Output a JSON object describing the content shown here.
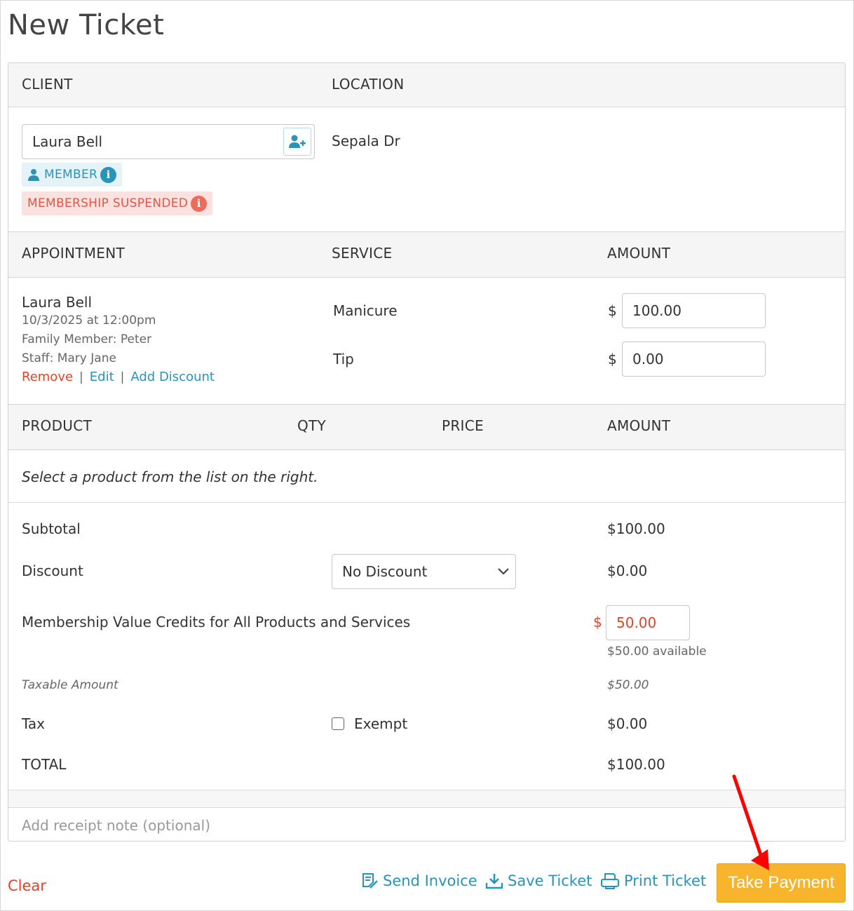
{
  "page": {
    "title": "New Ticket"
  },
  "client_section": {
    "client_header": "CLIENT",
    "location_header": "LOCATION",
    "client_name": "Laura Bell",
    "location_value": "Sepala Dr",
    "member_badge": "MEMBER",
    "suspended_badge": "MEMBERSHIP SUSPENDED"
  },
  "appointment_section": {
    "headers": {
      "appointment": "APPOINTMENT",
      "service": "SERVICE",
      "amount": "AMOUNT"
    },
    "client_name": "Laura Bell",
    "datetime": "10/3/2025 at 12:00pm",
    "family_member": "Family Member: Peter",
    "staff": "Staff: Mary Jane",
    "actions": {
      "remove": "Remove",
      "separator": "|",
      "edit": "Edit",
      "add_discount": "Add Discount"
    },
    "rows": [
      {
        "service": "Manicure",
        "currency": "$",
        "amount": "100.00"
      },
      {
        "service": "Tip",
        "currency": "$",
        "amount": "0.00"
      }
    ]
  },
  "product_section": {
    "headers": {
      "product": "PRODUCT",
      "qty": "QTY",
      "price": "PRICE",
      "amount": "AMOUNT"
    },
    "empty_message": "Select a product from the list on the right."
  },
  "totals": {
    "subtotal_label": "Subtotal",
    "subtotal_value": "$100.00",
    "discount_label": "Discount",
    "discount_select": "No Discount",
    "discount_value": "$0.00",
    "credits_label": "Membership Value Credits for All Products and Services",
    "credits_currency": "$",
    "credits_value": "50.00",
    "credits_available": "$50.00 available",
    "taxable_label": "Taxable Amount",
    "taxable_value": "$50.00",
    "tax_label": "Tax",
    "exempt_label": "Exempt",
    "tax_value": "$0.00",
    "total_label": "TOTAL",
    "total_value": "$100.00"
  },
  "receipt_note": {
    "placeholder": "Add receipt note (optional)"
  },
  "footer": {
    "clear": "Clear",
    "send_invoice": "Send Invoice",
    "save_ticket": "Save Ticket",
    "print_ticket": "Print Ticket",
    "take_payment": "Take Payment"
  },
  "colors": {
    "link": "#2a94b8",
    "danger": "#e0442b",
    "member_bg": "#e3f3f7",
    "suspended_bg": "#fbe1df",
    "primary_button": "#f7b42c",
    "annotation_arrow": "#ff0000"
  },
  "icons": [
    "add-client-icon",
    "person-icon",
    "info-icon",
    "chevron-down-icon",
    "invoice-icon",
    "download-icon",
    "printer-icon"
  ]
}
